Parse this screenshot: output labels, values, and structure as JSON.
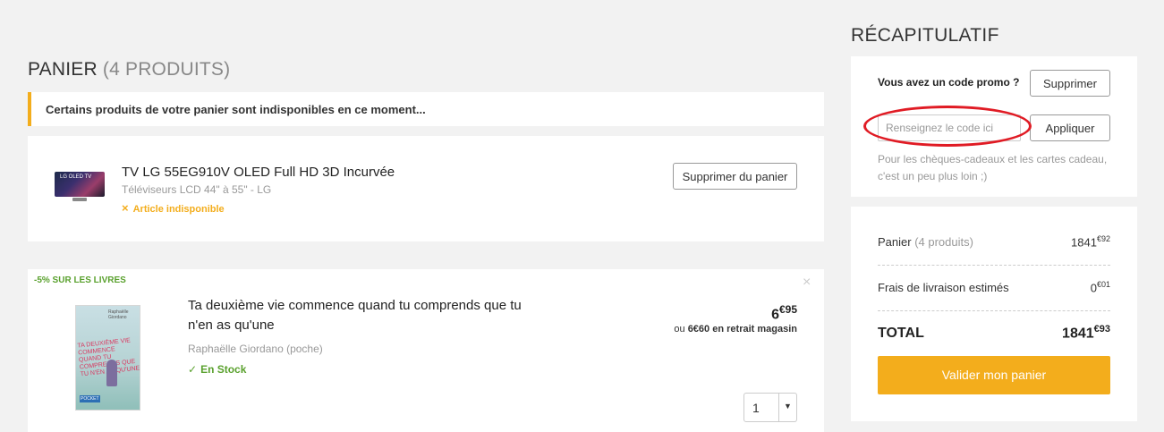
{
  "cart": {
    "title": "PANIER",
    "count": "(4 PRODUITS)",
    "warning": "Certains produits de votre panier sont indisponibles en ce moment...",
    "items": [
      {
        "title": "TV LG 55EG910V OLED Full HD 3D Incurvée",
        "subtitle": "Téléviseurs LCD 44\" à 55\" - LG",
        "status_icon": "×",
        "status": "Article indisponible",
        "remove_label": "Supprimer du panier",
        "thumb_text": "LG OLED TV"
      },
      {
        "promo": "-5% SUR LES LIVRES",
        "close_icon": "×",
        "title": "Ta deuxième vie commence quand tu comprends que tu n'en as qu'une",
        "author": "Raphaëlle Giordano (poche)",
        "status_icon": "✓",
        "status": "En Stock",
        "price_int": "6",
        "price_dec": "€95",
        "alt_prefix": "ou",
        "alt_price": "6€60",
        "alt_suffix": "en retrait magasin",
        "quantity": "1",
        "qty_arrow": "▼",
        "cover_title": "Ta deuxième vie commence quand tu comprends que tu n'en as qu'une",
        "cover_author": "Raphaëlle Giordano",
        "cover_publisher": "POCKET"
      }
    ]
  },
  "summary": {
    "title": "RÉCAPITULATIF",
    "promo_question": "Vous avez un code promo ?",
    "promo_remove": "Supprimer",
    "promo_placeholder": "Renseignez le code ici",
    "promo_apply": "Appliquer",
    "promo_note": "Pour les chèques-cadeaux et les cartes cadeau, c'est un peu plus loin ;)",
    "cart_label": "Panier",
    "cart_count": "(4 produits)",
    "cart_int": "1841",
    "cart_dec": "€92",
    "shipping_label": "Frais de livraison estimés",
    "shipping_int": "0",
    "shipping_dec": "€01",
    "total_label": "TOTAL",
    "total_int": "1841",
    "total_dec": "€93",
    "validate": "Valider mon panier"
  },
  "colors": {
    "accent": "#f3ad1c",
    "success": "#5aa12e",
    "highlight_circle": "#e01b24"
  }
}
